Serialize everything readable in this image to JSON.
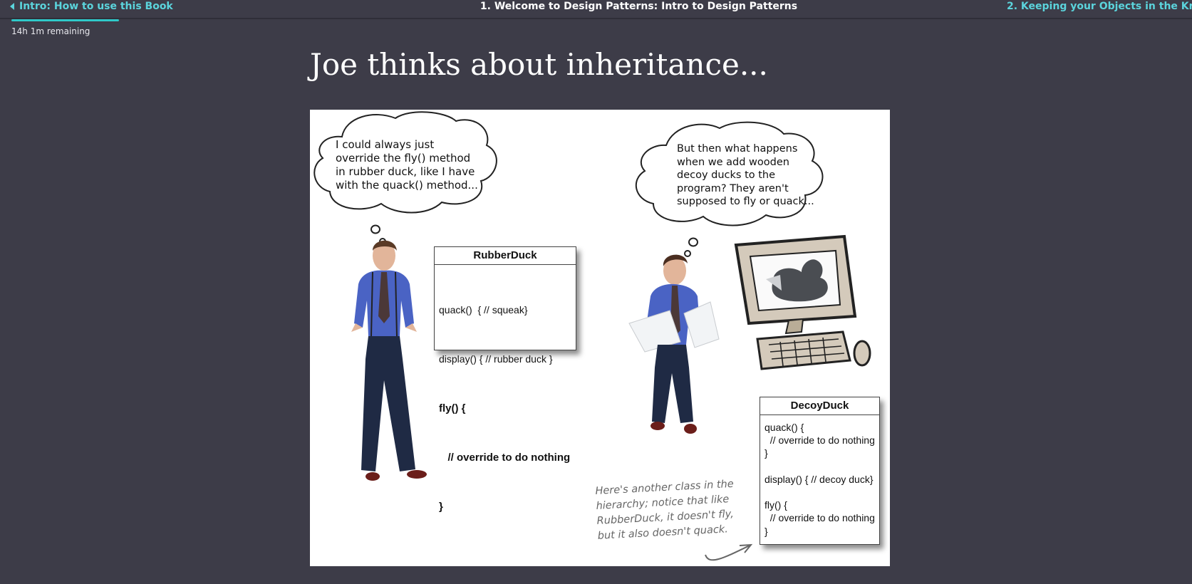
{
  "nav": {
    "prev_label": "Intro: How to use this Book",
    "chapter_title": "1. Welcome to Design Patterns: Intro to Design Patterns",
    "next_label": "2. Keeping your Objects in the Know: The Observer Pattern",
    "progress_fraction": 0.1,
    "remaining": "14h 1m remaining"
  },
  "page": {
    "title": "Joe thinks about inheritance..."
  },
  "figure": {
    "bubble_left": "I could always just\noverride the fly() method\nin rubber duck, like I have\nwith the quack() method...",
    "bubble_right": "But then what happens\nwhen we add wooden\ndecoy ducks to the\nprogram? They aren't\nsupposed to fly or quack...",
    "rubber_duck": {
      "header": "RubberDuck",
      "line1": "quack()  { // squeak}",
      "line2": "display() { // rubber duck }",
      "line3": "fly() {",
      "line4": "   // override to do nothing",
      "line5": "}"
    },
    "decoy_duck": {
      "header": "DecoyDuck",
      "body": "quack() {\n  // override to do nothing\n}\n\ndisplay() { // decoy duck}\n\nfly() {\n  // override to do nothing\n}"
    },
    "note": "Here's another class in the\nhierarchy; notice that like\nRubberDuck, it doesn't fly,\nbut it also doesn't quack."
  },
  "colors": {
    "background": "#3d3c48",
    "accent": "#5bd4dc",
    "progress": "#2fc9c9"
  },
  "icons": {
    "prev": "caret-left-icon"
  }
}
